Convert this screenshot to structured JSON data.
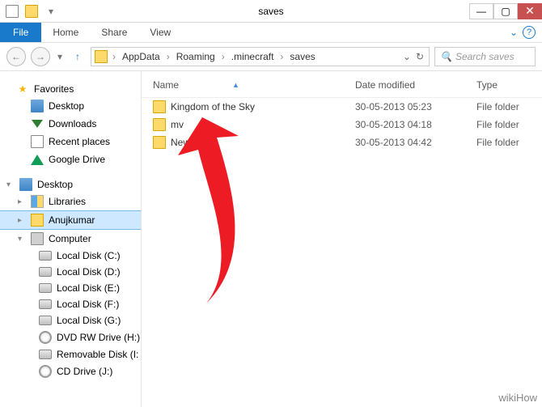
{
  "window": {
    "title": "saves"
  },
  "ribbon": {
    "file": "File",
    "tabs": [
      "Home",
      "Share",
      "View"
    ]
  },
  "breadcrumbs": [
    "AppData",
    "Roaming",
    ".minecraft",
    "saves"
  ],
  "search": {
    "placeholder": "Search saves"
  },
  "sidebar": {
    "favorites": {
      "label": "Favorites",
      "items": [
        {
          "label": "Desktop"
        },
        {
          "label": "Downloads"
        },
        {
          "label": "Recent places"
        },
        {
          "label": "Google Drive"
        }
      ]
    },
    "desktop": {
      "label": "Desktop",
      "libraries": "Libraries",
      "user": "Anujkumar",
      "computer": {
        "label": "Computer",
        "drives": [
          "Local Disk (C:)",
          "Local Disk (D:)",
          "Local Disk (E:)",
          "Local Disk (F:)",
          "Local Disk (G:)",
          "DVD RW Drive (H:)",
          "Removable Disk (I:",
          "CD Drive (J:)"
        ]
      }
    }
  },
  "columns": {
    "name": "Name",
    "date": "Date modified",
    "type": "Type"
  },
  "files": [
    {
      "name": "Kingdom of the Sky",
      "date": "30-05-2013 05:23",
      "type": "File folder"
    },
    {
      "name": "mv",
      "date": "30-05-2013 04:18",
      "type": "File folder"
    },
    {
      "name": "New World",
      "date": "30-05-2013 04:42",
      "type": "File folder"
    }
  ],
  "watermark": "wikiHow"
}
